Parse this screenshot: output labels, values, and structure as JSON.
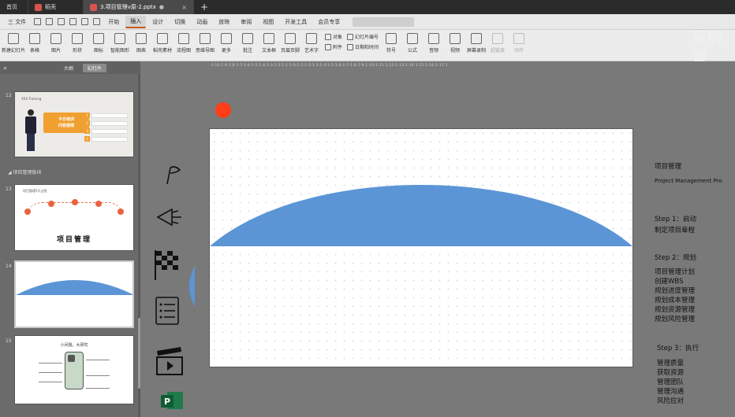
{
  "tabs": {
    "home": "首页",
    "second": "稻壳",
    "active": "3.项目管理v原-2.pptx",
    "new": "+"
  },
  "menu": {
    "file": "三 文件",
    "items": [
      "开始",
      "插入",
      "设计",
      "切换",
      "动画",
      "放映",
      "审阅",
      "视图",
      "开发工具",
      "会员专享"
    ],
    "active_index": 1
  },
  "ribbon": {
    "buttons": [
      "新建幻灯片",
      "表格",
      "图片",
      "形状",
      "图标",
      "智能图形",
      "图表",
      "稻壳素材",
      "流程图",
      "思维导图",
      "更多",
      "批注",
      "文本框",
      "页眉页脚",
      "艺术字"
    ],
    "small": {
      "object": "对象",
      "slide_number": "幻灯片编号",
      "attachment": "附件",
      "datetime": "日期和时间"
    },
    "buttons2": [
      "符号",
      "公式",
      "音频",
      "视频",
      "屏幕录制"
    ],
    "dim_buttons": [
      "超链接",
      "动作"
    ]
  },
  "watermark": "吴明课",
  "panel": {
    "tabs": [
      "大纲",
      "幻灯片"
    ],
    "active_tab": 1,
    "collapse": "«",
    "section_label": "◢ 项目管理板块",
    "slides": [
      {
        "num": "12"
      },
      {
        "num": "13"
      },
      {
        "num": "14"
      },
      {
        "num": "15"
      }
    ]
  },
  "thumb12": {
    "caption": "XXX Training",
    "badge_line1": "今日培训",
    "badge_line2": "内容提纲",
    "items": [
      "1",
      "2",
      "3",
      "4"
    ]
  },
  "thumb13": {
    "caption": "项目管理5大过程",
    "title": "项目管理"
  },
  "thumb15": {
    "caption": "小问题，大研究"
  },
  "ruler": "·1·10·1·9·1·8·1·7·1·6·1·5·1·4·1·3·1·2·1·1·1·0·1·1·1·2·1·3·1·4·1·5·1·6·1·7·1·8·1·9·1·10·1·11·1·12·1·13·1·14·1·15·1·16·1·17·1",
  "colors": {
    "arc_fill": "#5b95d6",
    "red_dot": "#ff3d17",
    "badge": "#f0a030",
    "node": "#e8633e"
  },
  "notes": {
    "title": "项目管理",
    "subtitle": "Project Management Pro",
    "step1_label": "Step 1：启动",
    "step1_item": "制定项目章程",
    "step2_label": "Step 2：规划",
    "step2_items": [
      "项目管理计划",
      "创建WBS",
      "规划进度管理",
      "规划成本管理",
      "规划资源管理",
      "规划风险管理"
    ],
    "step3_label": "Step 3：执行",
    "step3_items": [
      "管理质量",
      "获取资源",
      "管理团队",
      "管理沟通",
      "风险应对"
    ]
  },
  "icons": [
    "flag-icon",
    "megaphone-icon",
    "checkered-flag-icon",
    "list-icon",
    "clapperboard-icon",
    "project-app-icon"
  ]
}
